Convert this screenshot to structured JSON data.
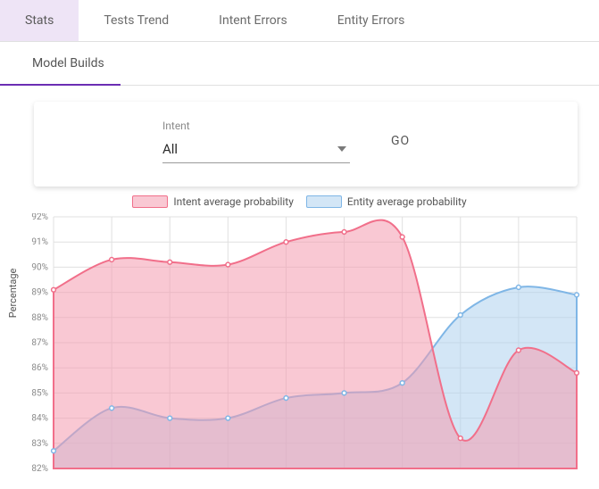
{
  "tabs": {
    "row1": [
      {
        "label": "Stats",
        "active": true
      },
      {
        "label": "Tests Trend",
        "active": false
      },
      {
        "label": "Intent Errors",
        "active": false
      },
      {
        "label": "Entity Errors",
        "active": false
      }
    ],
    "row2": [
      {
        "label": "Model Builds",
        "active": true
      }
    ]
  },
  "controls": {
    "select_label": "Intent",
    "select_value": "All",
    "go_label": "GO"
  },
  "legend": [
    {
      "key": "intent",
      "label": "Intent average probability",
      "swatch": "pink"
    },
    {
      "key": "entity",
      "label": "Entity average probability",
      "swatch": "blue"
    }
  ],
  "chart_data": {
    "type": "area",
    "title": "",
    "xlabel": "",
    "ylabel": "Percentage",
    "ylim": [
      82,
      92
    ],
    "yticks": [
      82,
      83,
      84,
      85,
      86,
      87,
      88,
      89,
      90,
      91,
      92
    ],
    "x": [
      0,
      1,
      2,
      3,
      4,
      5,
      6,
      7,
      8,
      9
    ],
    "series": [
      {
        "name": "Intent average probability",
        "color": "pink",
        "values": [
          89.1,
          90.3,
          90.2,
          90.1,
          91.0,
          91.4,
          91.2,
          83.2,
          86.7,
          85.8
        ]
      },
      {
        "name": "Entity average probability",
        "color": "blue",
        "values": [
          82.7,
          84.4,
          84.0,
          84.0,
          84.8,
          85.0,
          85.4,
          88.1,
          89.2,
          88.9
        ]
      }
    ],
    "legend_position": "top"
  }
}
